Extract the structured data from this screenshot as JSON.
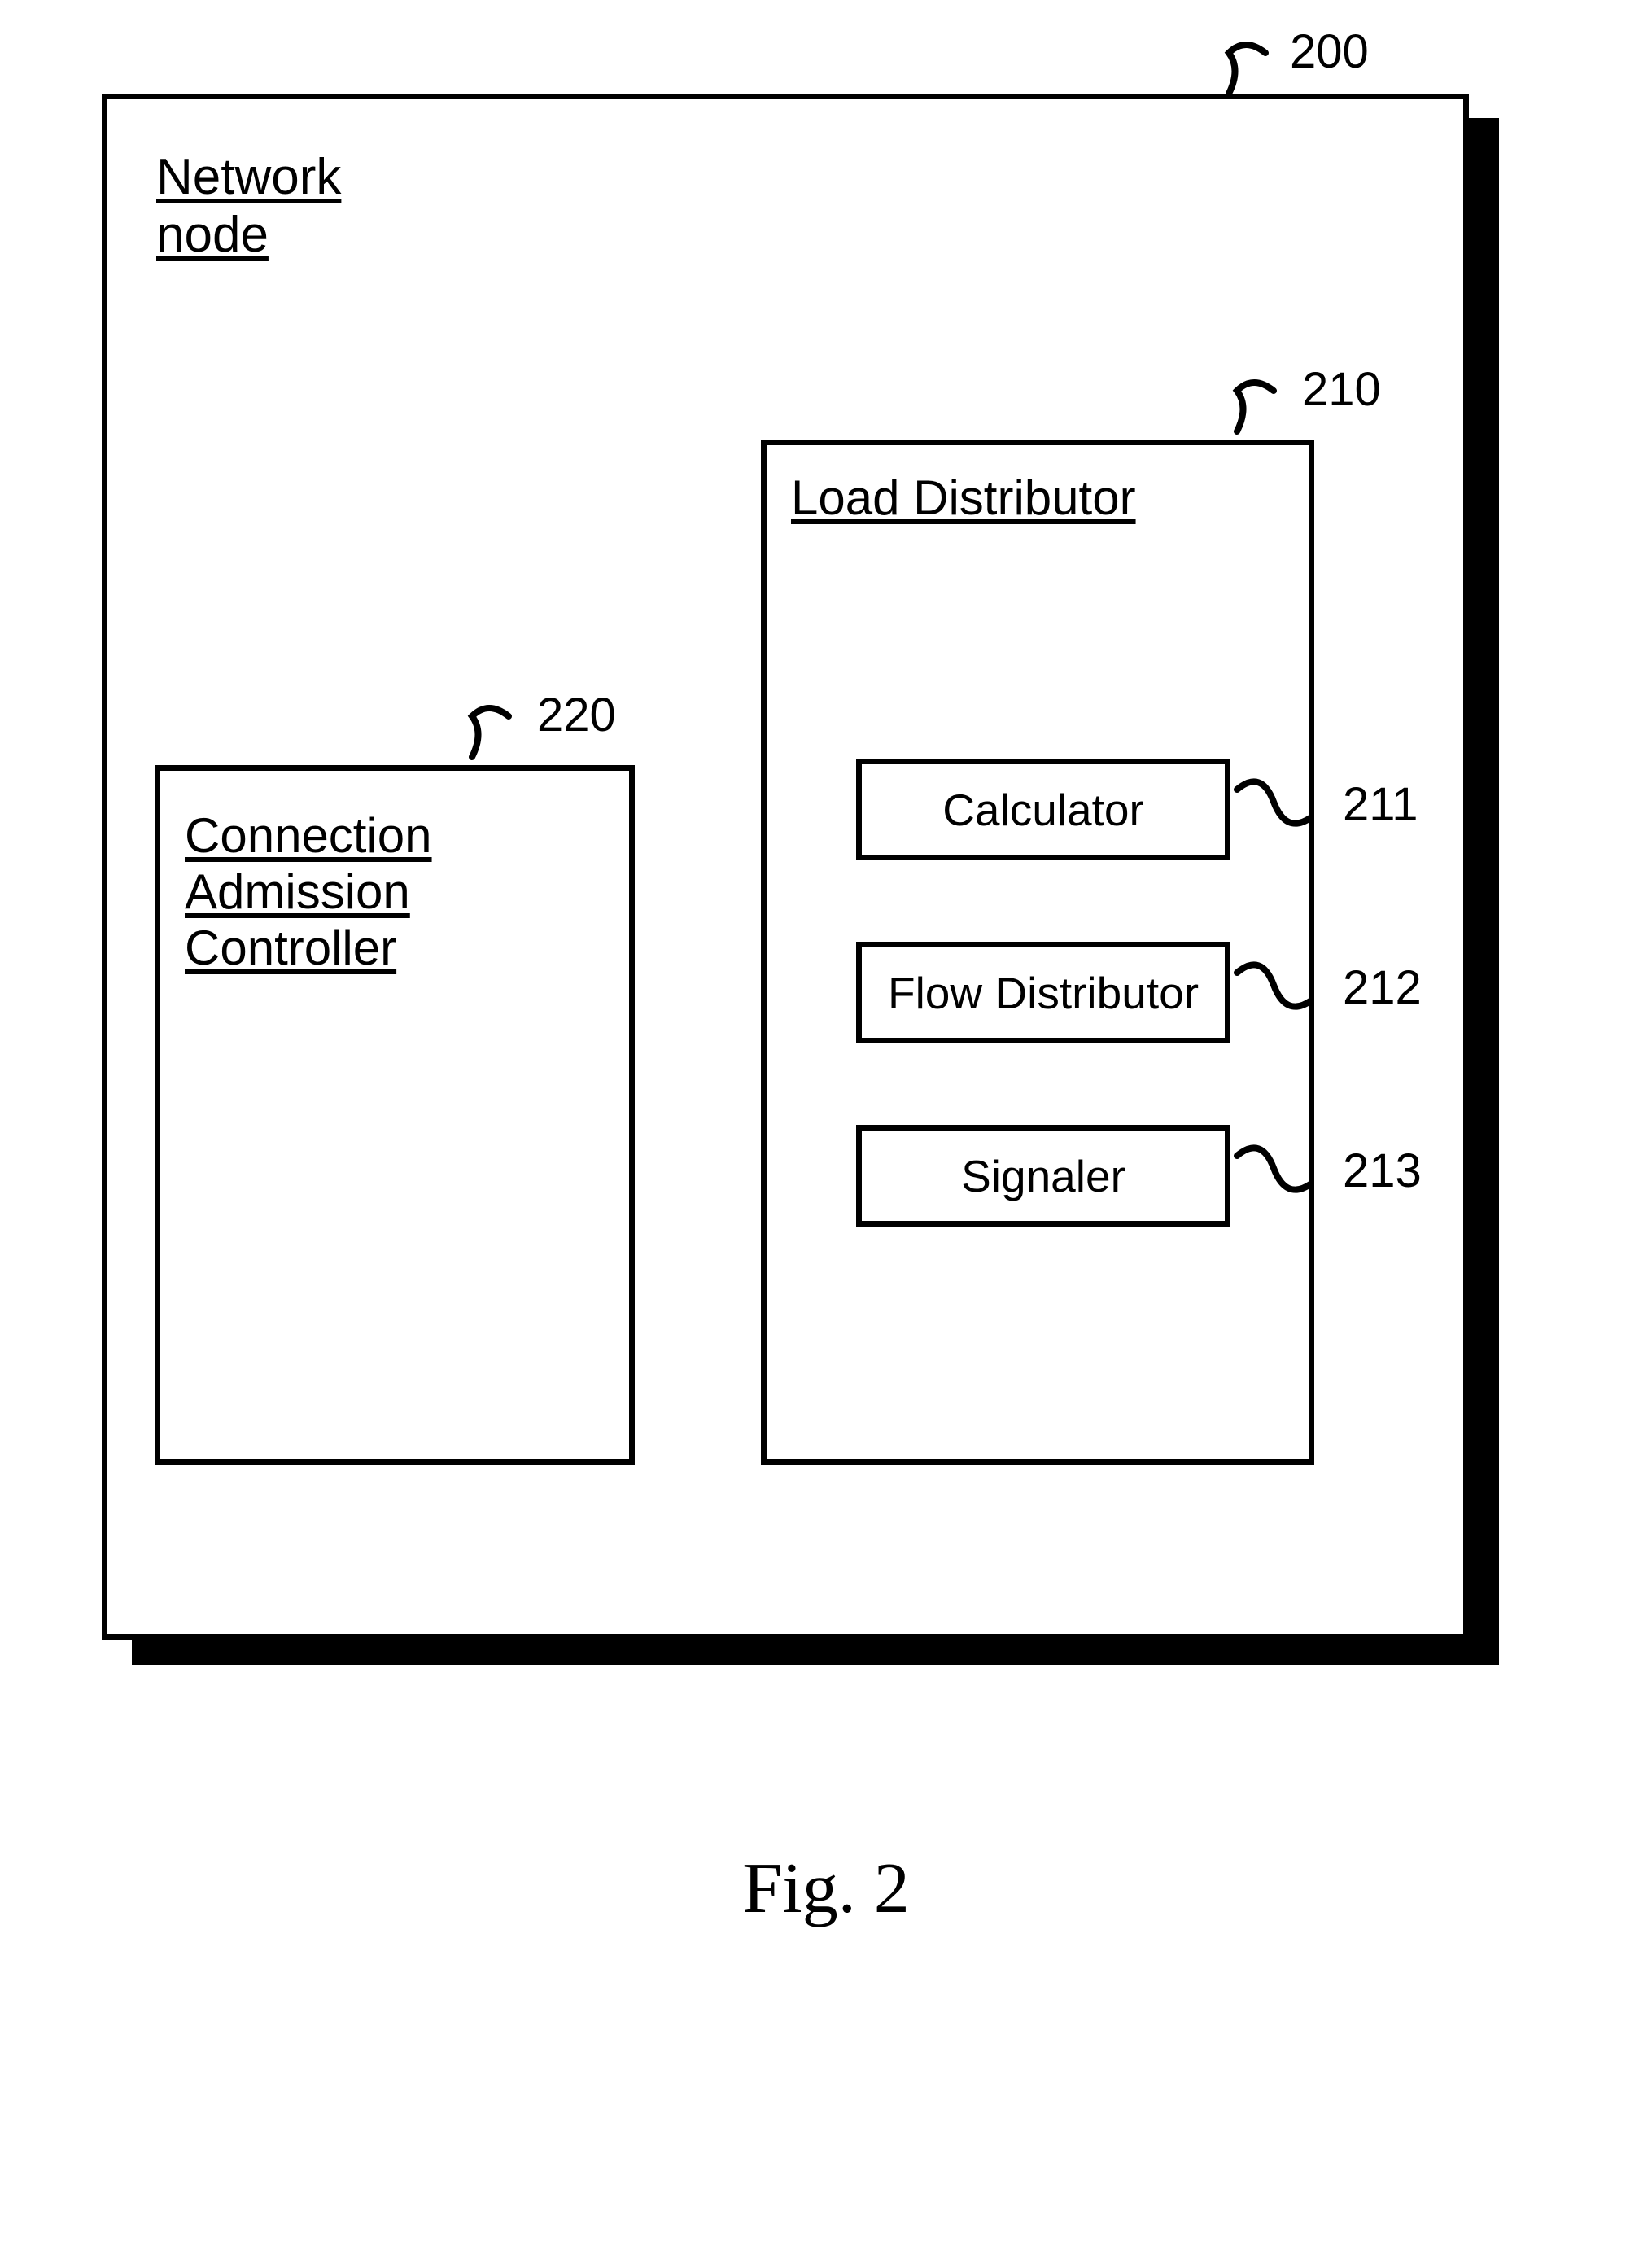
{
  "outer": {
    "title_line1": "Network",
    "title_line2": "node",
    "ref": "200"
  },
  "cac": {
    "title_line1": "Connection",
    "title_line2": "Admission",
    "title_line3": "Controller",
    "ref": "220"
  },
  "ld": {
    "title": "Load Distributor",
    "ref": "210"
  },
  "sub": {
    "calc": {
      "label": "Calculator",
      "ref": "211"
    },
    "flow": {
      "label": "Flow Distributor",
      "ref": "212"
    },
    "sig": {
      "label": "Signaler",
      "ref": "213"
    }
  },
  "caption": "Fig. 2"
}
